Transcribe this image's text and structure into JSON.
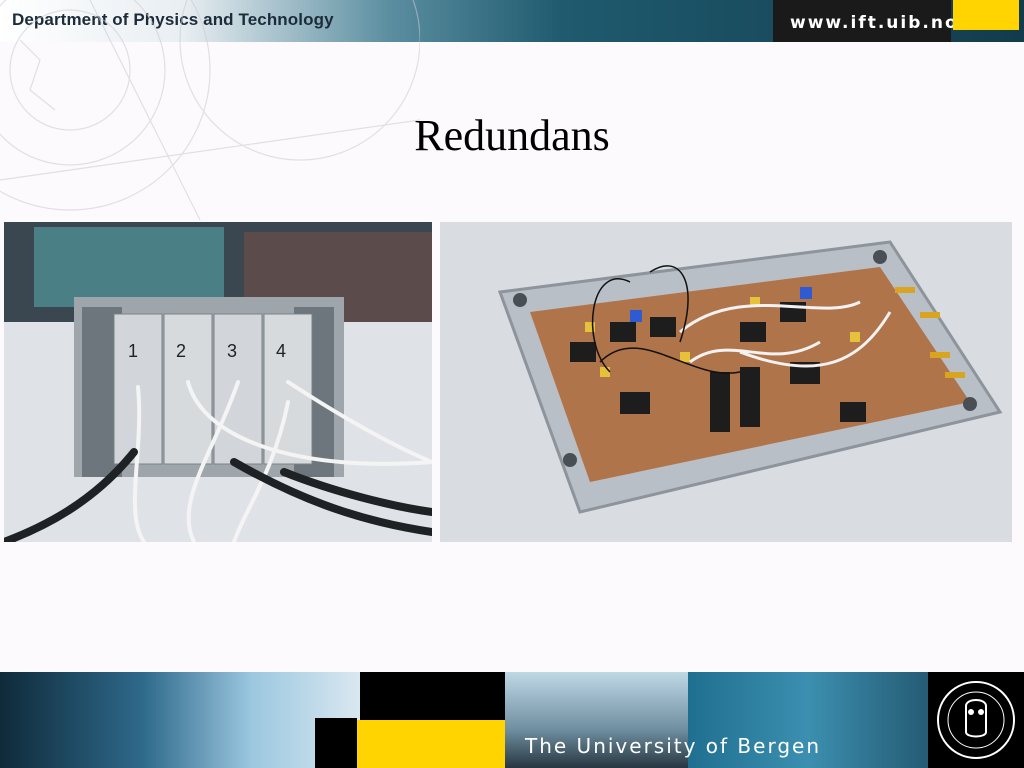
{
  "header": {
    "department": "Department of Physics and Technology",
    "url": "www.ift.uib.no"
  },
  "slide": {
    "title": "Redundans"
  },
  "photos": [
    {
      "alt": "Aluminium module housing with four numbered slots and white cables"
    },
    {
      "alt": "Open aluminium enclosure with circuit board, chips and coaxial connectors"
    }
  ],
  "photo1_labels": [
    "1",
    "2",
    "3",
    "4"
  ],
  "footer": {
    "university": "The University of Bergen"
  },
  "colors": {
    "header_dark": "#123c4c",
    "accent_yellow": "#ffd400",
    "footer_dark": "#101316"
  }
}
